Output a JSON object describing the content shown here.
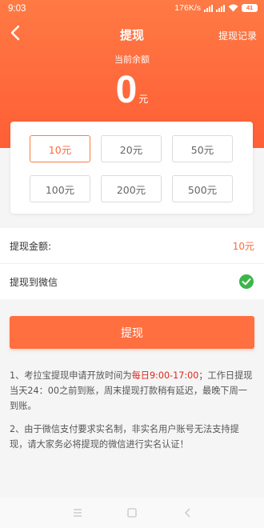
{
  "status": {
    "time": "9:03",
    "speed": "176K/s",
    "battery": "41"
  },
  "nav": {
    "title": "提现",
    "record_label": "提现记录"
  },
  "balance": {
    "label": "当前余额",
    "value": "0",
    "unit": "元"
  },
  "amounts": {
    "selected_index": 0,
    "options": [
      "10元",
      "20元",
      "50元",
      "100元",
      "200元",
      "500元"
    ]
  },
  "withdraw_amount": {
    "label": "提现金额:",
    "value": "10元"
  },
  "withdraw_to": {
    "label": "提现到微信",
    "checked": true
  },
  "submit_label": "提现",
  "notes": {
    "note1_prefix": "1、考拉宝提现申请开放时间为",
    "note1_highlight": "每日9:00-17:00",
    "note1_suffix": "；工作日提现当天24：00之前到账，周末提现打款稍有延迟，最晚下周一到账。",
    "note2": "2、由于微信支付要求实名制，非实名用户账号无法支持提现，请大家务必将提现的微信进行实名认证！"
  },
  "colors": {
    "accent": "#ff6a3c",
    "highlight": "#e0261b",
    "check": "#3db54a"
  }
}
